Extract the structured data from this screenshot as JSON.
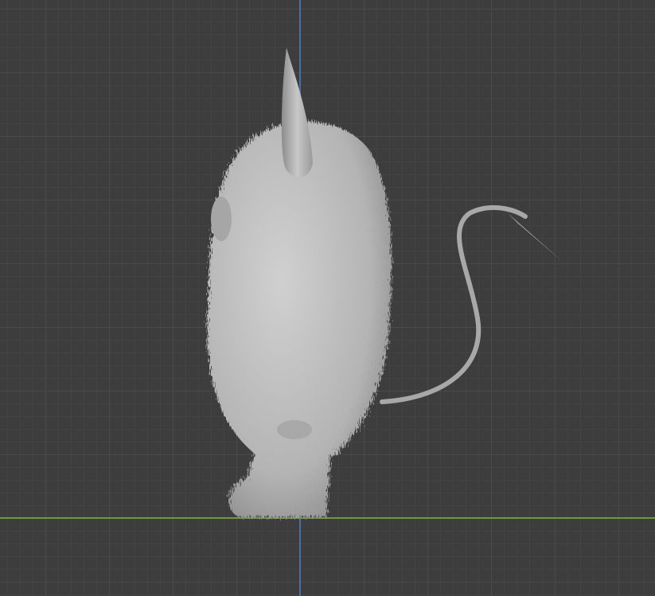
{
  "viewport": {
    "background_color": "#3d3d3d",
    "z_axis_color": "#4a6fa8",
    "y_axis_color": "#6f9a3a",
    "model_color": "#b8b8b8"
  }
}
